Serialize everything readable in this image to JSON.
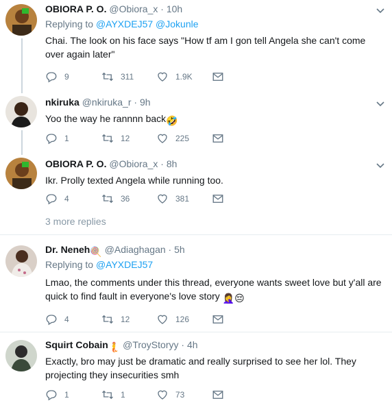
{
  "tweets": [
    {
      "name": "OBIORA P. O.",
      "handle": "@Obiora_x",
      "dot": "·",
      "time": "10h",
      "replying_prefix": "Replying to ",
      "replying_to": "@AYXDEJ57 @Jokunle",
      "text": "Chai. The look on his face says \"How tf am I gon tell Angela she can't come over again later\"",
      "replies": "9",
      "retweets": "311",
      "likes": "1.9K"
    },
    {
      "name": "nkiruka",
      "handle": "@nkiruka_r",
      "dot": "·",
      "time": "9h",
      "text": "Yoo the way he rannnn back",
      "text_emoji": "🤣",
      "replies": "1",
      "retweets": "12",
      "likes": "225"
    },
    {
      "name": "OBIORA P. O.",
      "handle": "@Obiora_x",
      "dot": "·",
      "time": "8h",
      "text": "Ikr. Prolly texted Angela while running too.",
      "replies": "4",
      "retweets": "36",
      "likes": "381"
    },
    {
      "name": "Dr. Neneh",
      "name_emoji": "🍭",
      "handle": "@Adiaghagan",
      "dot": "·",
      "time": "5h",
      "replying_prefix": "Replying to ",
      "replying_to": "@AYXDEJ57",
      "text": "Lmao, the comments under this thread, everyone wants sweet love but y'all are quick to find fault in everyone's love story",
      "text_emoji": "🤦‍♀️😔",
      "replies": "4",
      "retweets": "12",
      "likes": "126"
    },
    {
      "name": "Squirt Cobain",
      "name_emoji": "🧜",
      "handle": "@TroyStoryy",
      "dot": "·",
      "time": "4h",
      "text": "Exactly, bro may just be dramatic and really surprised to see her lol. They projecting they insecurities smh",
      "replies": "1",
      "retweets": "1",
      "likes": "73"
    }
  ],
  "more_replies": "3 more replies",
  "colors": {
    "text": "#14171a",
    "secondary": "#657786",
    "link": "#1da1f2",
    "divider": "#e6ecf0",
    "thread_line": "#ccd6dd"
  },
  "icons": [
    "reply-icon",
    "retweet-icon",
    "like-icon",
    "direct-message-icon",
    "caret-down-icon"
  ]
}
